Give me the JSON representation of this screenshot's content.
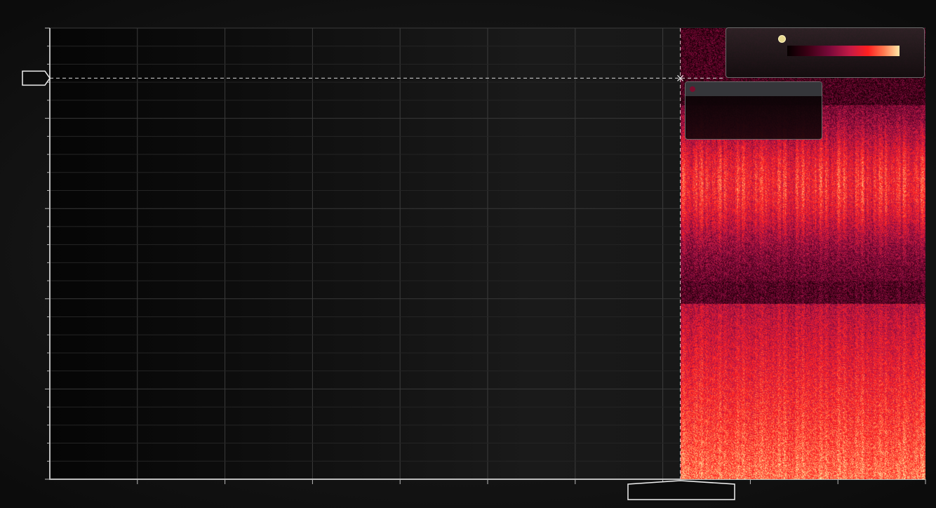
{
  "chart_data": {
    "type": "heatmap",
    "title": "",
    "xlabel": "",
    "ylabel": "",
    "xlim": [
      0,
      1
    ],
    "ylim": [
      0,
      1
    ],
    "heatmap_extent": {
      "x": [
        0.72,
        1.0
      ],
      "y": [
        0.0,
        1.0
      ]
    },
    "grid": true,
    "colormap": [
      "#050000",
      "#3a0014",
      "#7a0a3a",
      "#c41a46",
      "#ff2020",
      "#ff7a50",
      "#ffe8a8"
    ],
    "legend_placement": "top-right",
    "crosshair": {
      "x": 0.72,
      "y": 0.889
    },
    "tooltip": {
      "swatch_color": "#7a0d2e"
    },
    "legend_swatch_color": "#e6d890"
  }
}
